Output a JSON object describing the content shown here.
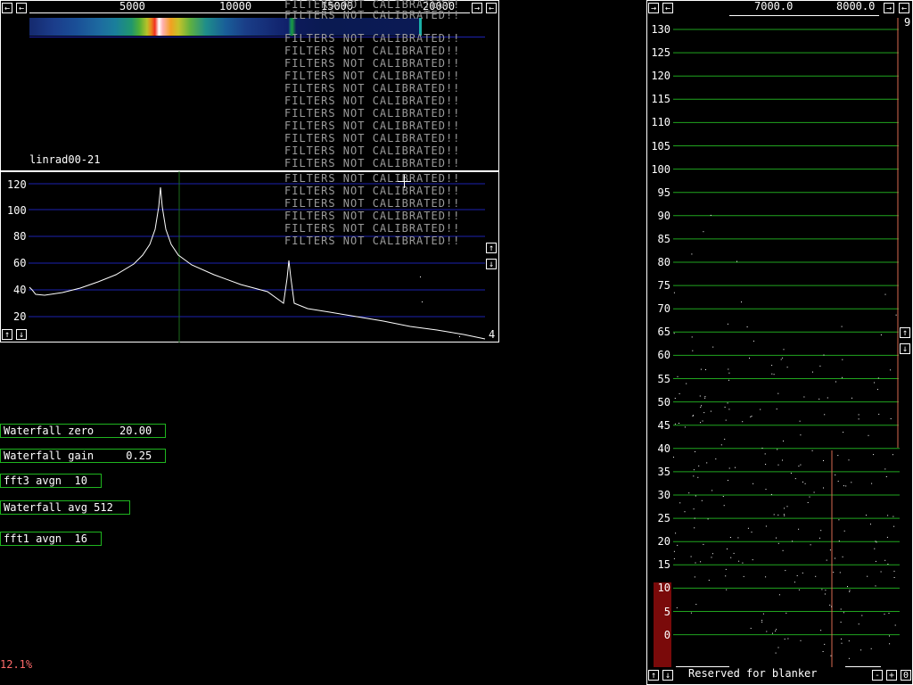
{
  "top_panel": {
    "freq_ticks": [
      "5000",
      "10000",
      "15000",
      "20000"
    ],
    "program_label": "linrad00-21",
    "filters_warning": "FILTERS NOT CALIBRATED!!",
    "scale_number": "4"
  },
  "spectrum": {
    "y_ticks": [
      "120",
      "100",
      "80",
      "60",
      "40",
      "20"
    ]
  },
  "params": {
    "waterfall_zero": "Waterfall zero    20.00",
    "waterfall_gain": "Waterfall gain     0.25",
    "fft3_avgn": "fft3 avgn  10",
    "waterfall_avg": "Waterfall avg 512",
    "fft1_avgn": "fft1 avgn  16"
  },
  "cpu_load": "12.1%",
  "right_panel": {
    "freq_ticks": [
      "7000.0",
      "8000.0"
    ],
    "corner_number": "9",
    "y_ticks": [
      "130",
      "125",
      "120",
      "115",
      "110",
      "105",
      "100",
      "95",
      "90",
      "85",
      "80",
      "75",
      "70",
      "65",
      "60",
      "55",
      "50",
      "45",
      "40",
      "35",
      "30",
      "25",
      "20",
      "15",
      "10",
      "5",
      "0"
    ],
    "bottom_label": "Reserved for blanker",
    "buttons": {
      "minus": "-",
      "plus": "+",
      "zero": "0"
    }
  },
  "colors": {
    "grid_blue": "#1d22b0",
    "grid_green": "#21a51f",
    "param_border": "#1fb51f",
    "red_marker": "#d96a50",
    "warning_gray": "#9a9a9a",
    "cpu_text": "#ff6a6a"
  }
}
